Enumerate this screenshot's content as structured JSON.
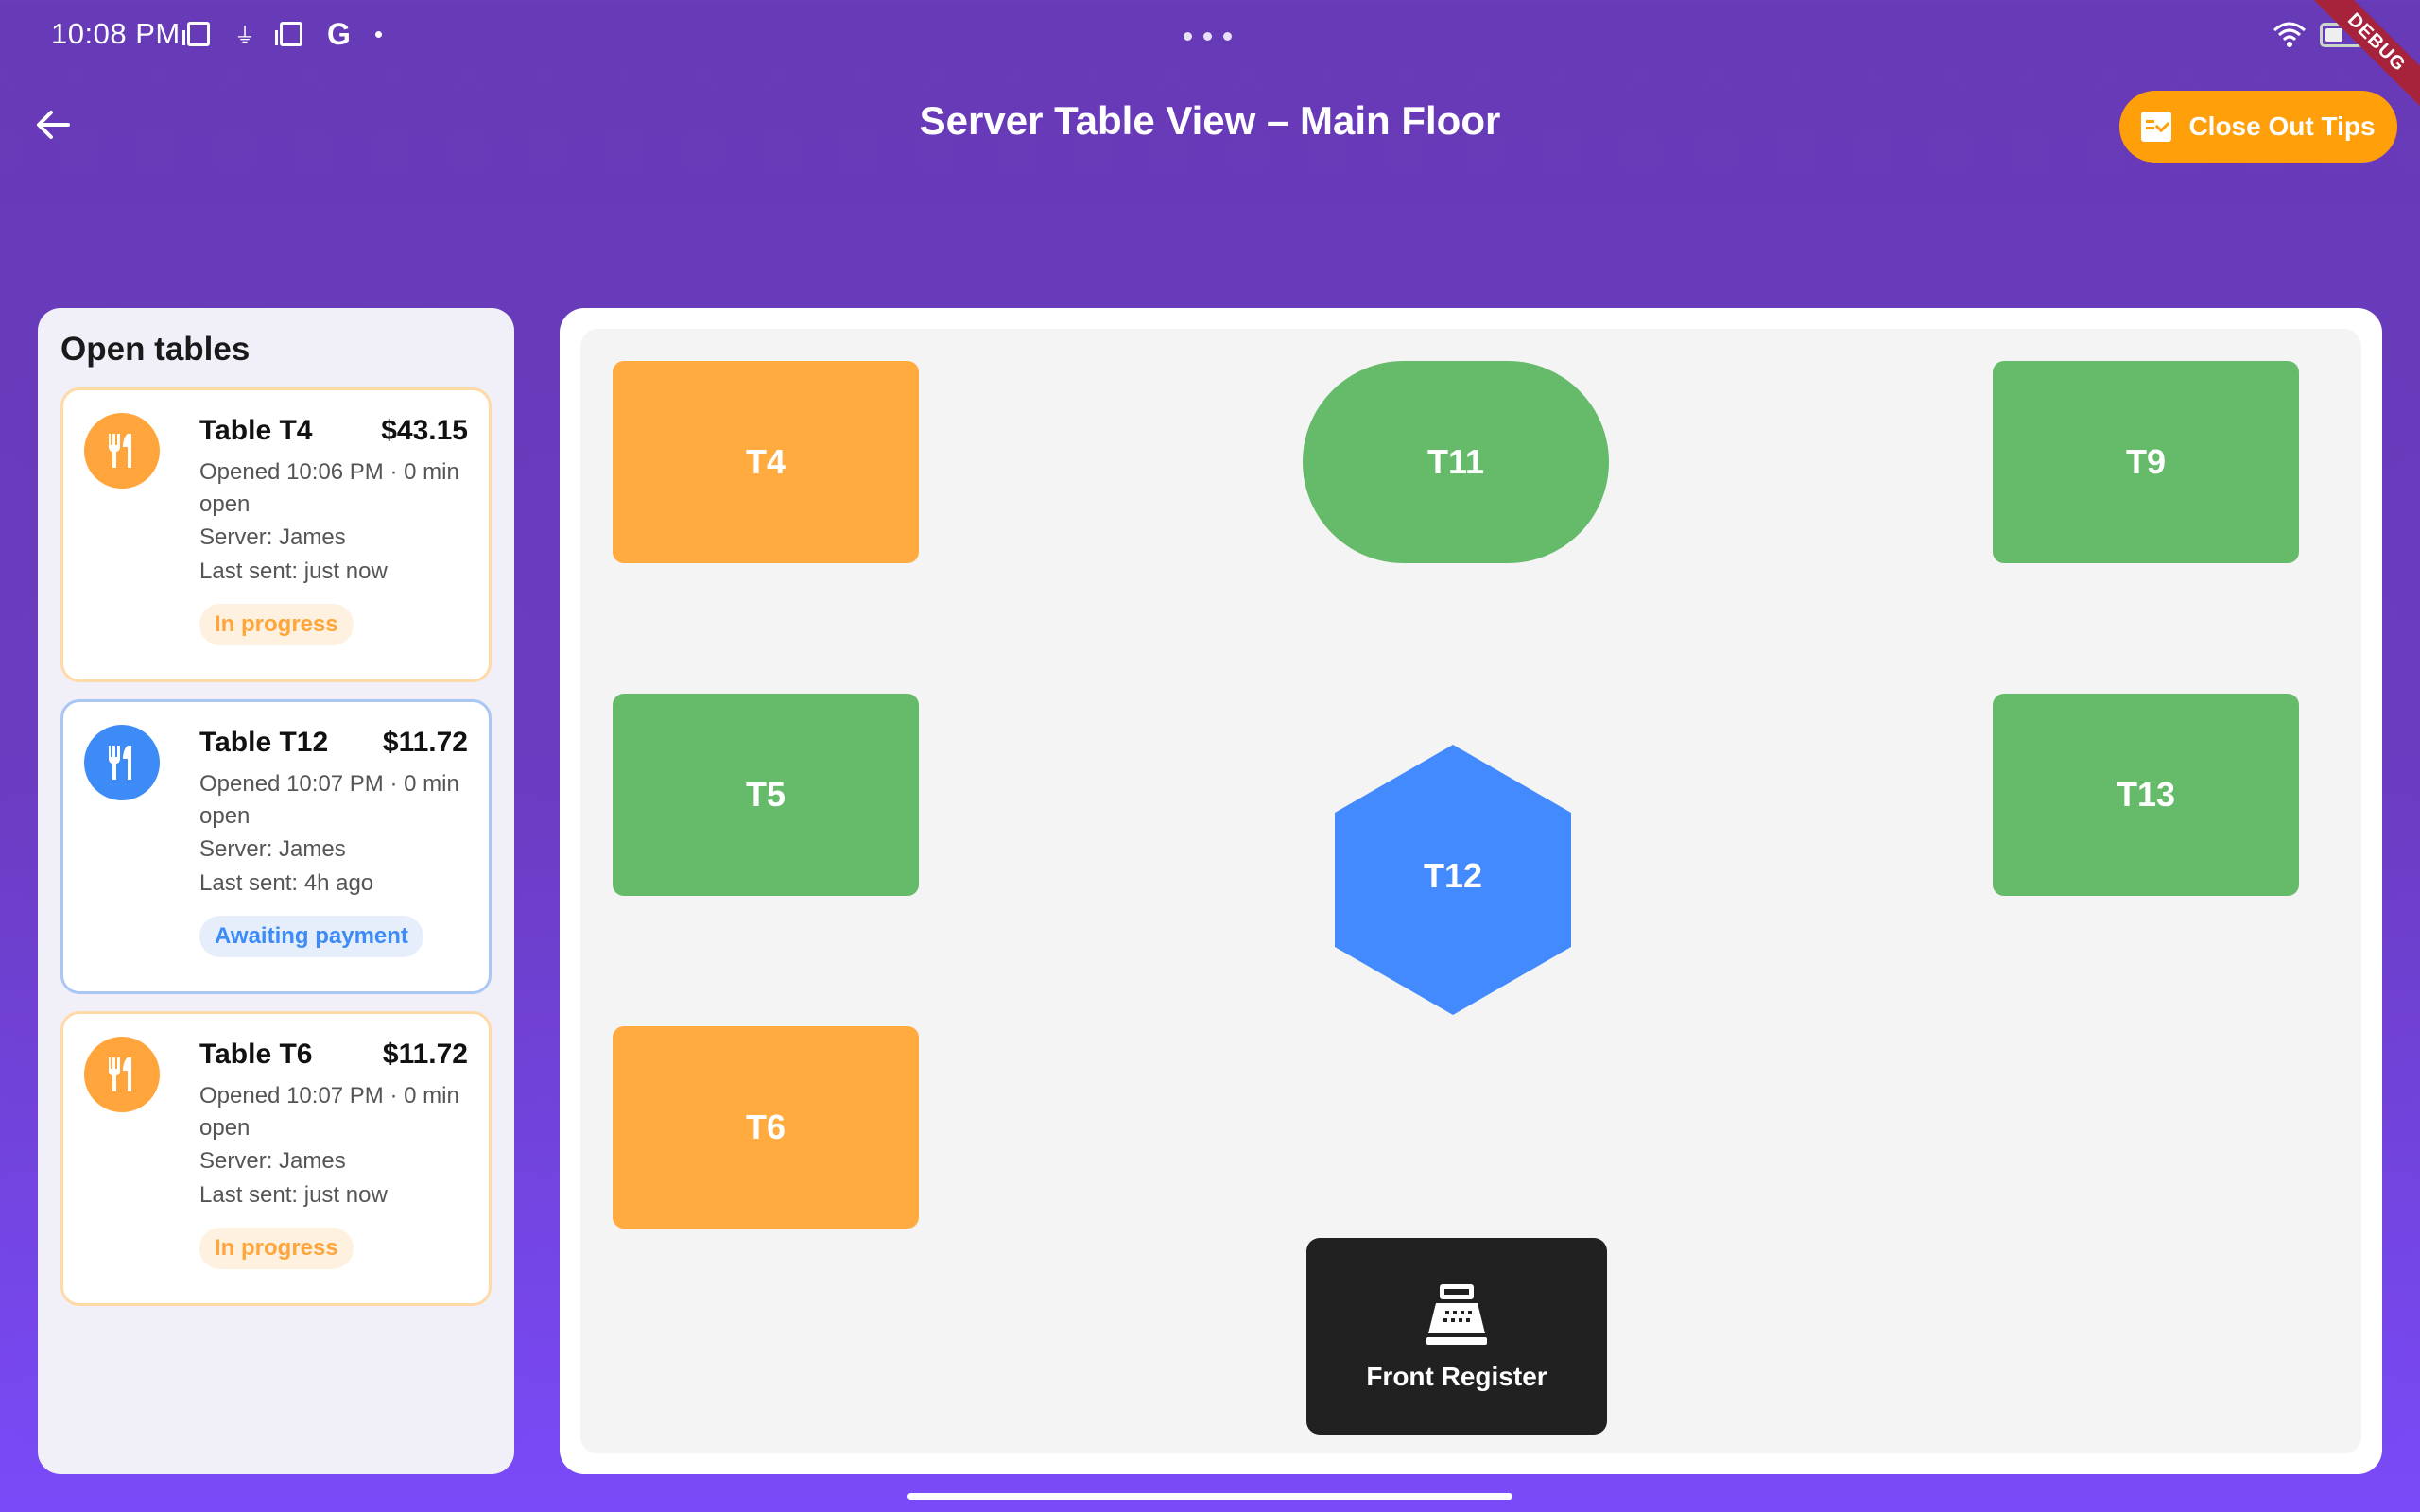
{
  "status_bar": {
    "time": "10:08 PM",
    "debug_label": "DEBUG"
  },
  "app_bar": {
    "title": "Server Table View – Main Floor",
    "close_tips_label": "Close Out Tips"
  },
  "sidebar": {
    "title": "Open tables",
    "tables": [
      {
        "name": "Table T4",
        "amount": "$43.15",
        "opened": "Opened 10:06 PM · 0 min",
        "opened_wrap": "open",
        "server": "Server: James",
        "last_sent": "Last sent: just now",
        "status": "In progress",
        "color": "#ffa53b"
      },
      {
        "name": "Table T12",
        "amount": "$11.72",
        "opened": "Opened 10:07 PM · 0 min",
        "opened_wrap": "open",
        "server": "Server: James",
        "last_sent": "Last sent: 4h ago",
        "status": "Awaiting payment",
        "color": "#3d8bf7"
      },
      {
        "name": "Table T6",
        "amount": "$11.72",
        "opened": "Opened 10:07 PM · 0 min",
        "opened_wrap": "open",
        "server": "Server: James",
        "last_sent": "Last sent: just now",
        "status": "In progress",
        "color": "#ffa53b"
      }
    ]
  },
  "floor": {
    "tables": {
      "t4": "T4",
      "t11": "T11",
      "t9": "T9",
      "t5": "T5",
      "t12": "T12",
      "t13": "T13",
      "t6": "T6"
    },
    "register_label": "Front Register"
  },
  "colors": {
    "in_progress": "#ffab40",
    "available": "#66bb6a",
    "awaiting_payment": "#448aff",
    "accent": "#ff9f0a",
    "app_bar": "#673ab7"
  }
}
